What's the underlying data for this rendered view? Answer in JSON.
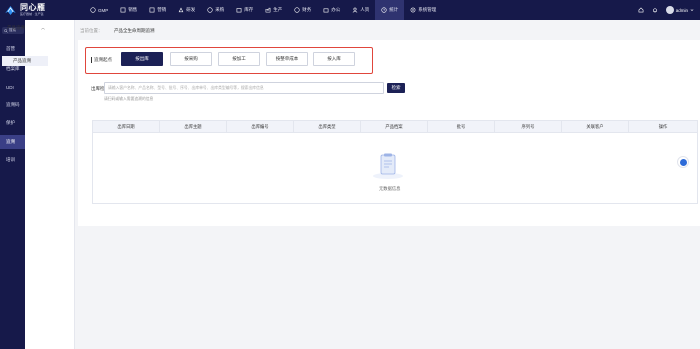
{
  "brand": {
    "name": "同心雁",
    "tagline": "医疗器械 · 生产链"
  },
  "nav": [
    {
      "label": "GMP",
      "icon": "gmp-icon"
    },
    {
      "label": "销售",
      "icon": "sales-icon"
    },
    {
      "label": "营销",
      "icon": "marketing-icon"
    },
    {
      "label": "研发",
      "icon": "rnd-icon"
    },
    {
      "label": "采购",
      "icon": "purchase-icon"
    },
    {
      "label": "库存",
      "icon": "inventory-icon"
    },
    {
      "label": "生产",
      "icon": "production-icon"
    },
    {
      "label": "财务",
      "icon": "finance-icon"
    },
    {
      "label": "办公",
      "icon": "office-icon"
    },
    {
      "label": "人资",
      "icon": "hr-icon"
    },
    {
      "label": "统计",
      "icon": "stats-icon"
    },
    {
      "label": "系统管理",
      "icon": "settings-icon"
    }
  ],
  "user": {
    "name": "admin"
  },
  "sidebar": {
    "search_placeholder": "搜索",
    "items": [
      "首营",
      "档案库",
      "UDI",
      "追溯码",
      "保护",
      "追溯",
      "培训"
    ]
  },
  "subnav": {
    "group": "产品追溯",
    "item": "产品追溯"
  },
  "breadcrumb": {
    "prefix": "当前位置",
    "current": "产品全生命周期追溯"
  },
  "tabs": {
    "group_label": "追溯起点",
    "items": [
      "按出库",
      "按采购",
      "按加工",
      "按整单成本",
      "按入库"
    ],
    "active_index": 0
  },
  "search": {
    "label": "出库检索:",
    "placeholder": "请输入客户名称、产品名称、型号、批号、序号、出库单号、出库类型编号等，搜索出库信息",
    "button": "检索",
    "hint": "请扫码或输入需要追溯的信息"
  },
  "table": {
    "columns": [
      "出库日期",
      "出库主题",
      "出库编号",
      "出库类型",
      "产品档案",
      "批号",
      "序列号",
      "关联客户",
      "操作"
    ],
    "empty_text": "无数据信息"
  }
}
